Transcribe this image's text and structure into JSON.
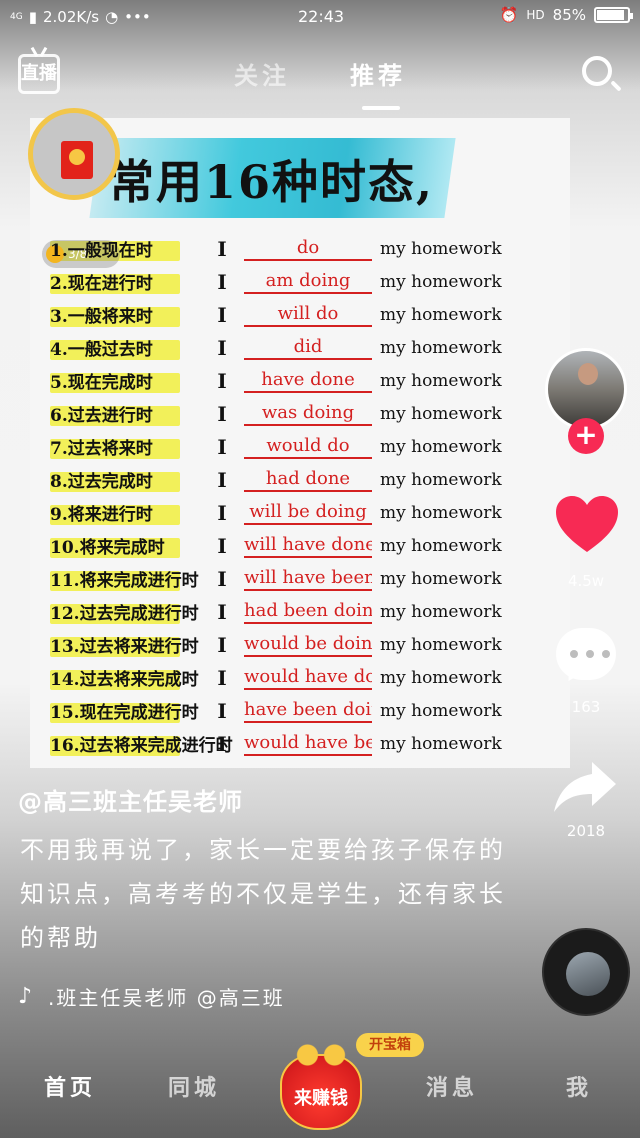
{
  "status_bar": {
    "signal": "4G",
    "net_speed": "2.02K/s",
    "more": "•••",
    "time": "22:43",
    "hd": "HD",
    "battery": "85%"
  },
  "top_nav": {
    "live_label": "直播",
    "tabs": [
      {
        "label": "关注",
        "active": false
      },
      {
        "label": "推荐",
        "active": true
      }
    ]
  },
  "progress_badge": "3/8",
  "video_content": {
    "title": "常用16种时态,",
    "rows": [
      {
        "name": "1.一般现在时",
        "subject": "I",
        "verb": "do",
        "object": "my homework"
      },
      {
        "name": "2.现在进行时",
        "subject": "I",
        "verb": "am doing",
        "object": "my homework"
      },
      {
        "name": "3.一般将来时",
        "subject": "I",
        "verb": "will do",
        "object": "my homework"
      },
      {
        "name": "4.一般过去时",
        "subject": "I",
        "verb": "did",
        "object": "my homework"
      },
      {
        "name": "5.现在完成时",
        "subject": "I",
        "verb": "have done",
        "object": "my homework"
      },
      {
        "name": "6.过去进行时",
        "subject": "I",
        "verb": "was doing",
        "object": "my homework"
      },
      {
        "name": "7.过去将来时",
        "subject": "I",
        "verb": "would do",
        "object": "my homework"
      },
      {
        "name": "8.过去完成时",
        "subject": "I",
        "verb": "had done",
        "object": "my homework"
      },
      {
        "name": "9.将来进行时",
        "subject": "I",
        "verb": "will be doing",
        "object": "my homework"
      },
      {
        "name": "10.将来完成时",
        "subject": "I",
        "verb": "will have done",
        "object": "my homework"
      },
      {
        "name": "11.将来完成进行时",
        "subject": "I",
        "verb": "will have been doing",
        "object": "my homework"
      },
      {
        "name": "12.过去完成进行时",
        "subject": "I",
        "verb": "had been doing",
        "object": "my homework"
      },
      {
        "name": "13.过去将来进行时",
        "subject": "I",
        "verb": "would be doing",
        "object": "my homework"
      },
      {
        "name": "14.过去将来完成时",
        "subject": "I",
        "verb": "would have done",
        "object": "my homework"
      },
      {
        "name": "15.现在完成进行时",
        "subject": "I",
        "verb": "have been doing",
        "object": "my homework"
      },
      {
        "name": "16.过去将来完成进行时",
        "subject": "I",
        "verb": "would have been doing",
        "object": "my homework"
      }
    ]
  },
  "actions": {
    "follow": "+",
    "likes": "4.5w",
    "comments": "163",
    "shares": "2018"
  },
  "post": {
    "author": "@高三班主任吴老师",
    "caption": "不用我再说了，家长一定要给孩子保存的知识点，高考考的不仅是学生，还有家长的帮助",
    "music": ".班主任吴老师    @高三班"
  },
  "bottom_nav": {
    "home": "首页",
    "city": "同城",
    "earn": "来赚钱",
    "treasure": "开宝箱",
    "messages": "消息",
    "me": "我"
  },
  "colors": {
    "accent_red": "#f72a54",
    "highlight_yellow": "#f2f05a",
    "answer_red": "#d42020",
    "title_band": "#1fb5cf"
  },
  "icons": [
    "search-icon",
    "heart-icon",
    "comment-icon",
    "share-icon",
    "music-note-icon",
    "wifi-icon",
    "alarm-icon",
    "red-packet-icon"
  ]
}
